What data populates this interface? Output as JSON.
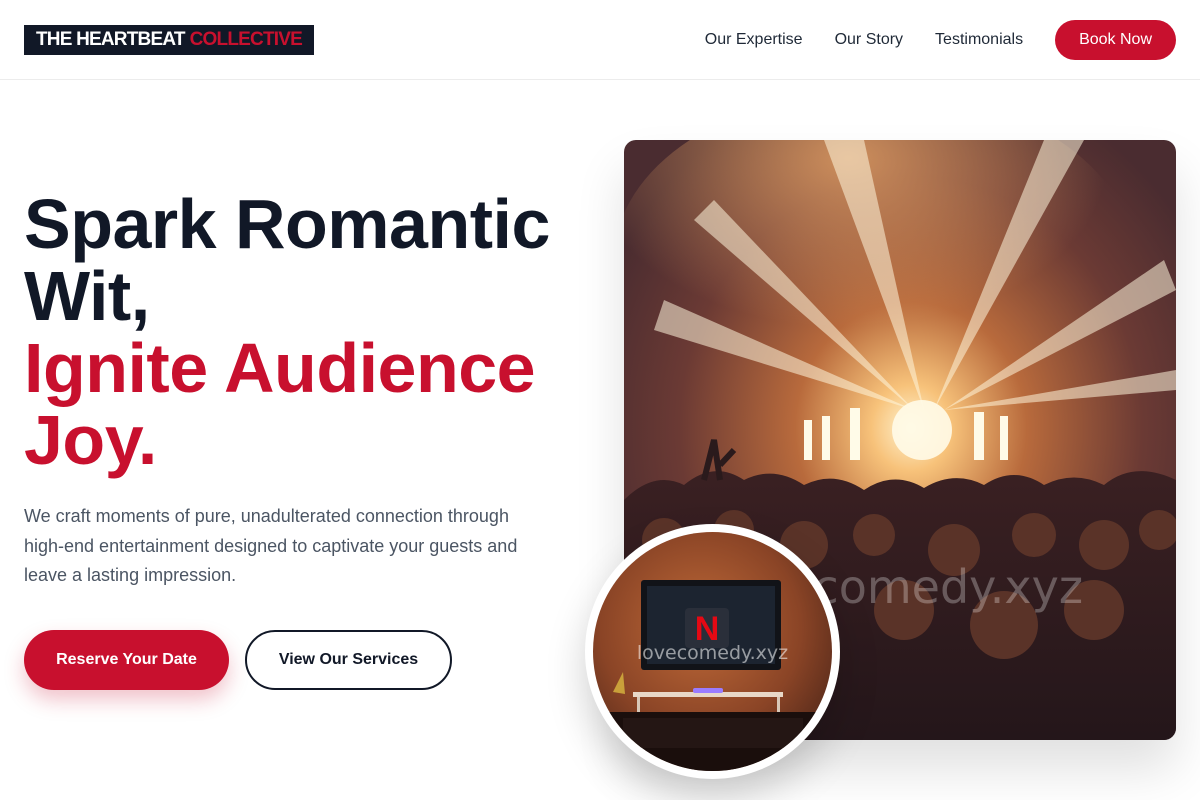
{
  "header": {
    "logo_part1": "THE HEARTBEAT",
    "logo_part2": "COLLECTIVE",
    "nav": [
      {
        "label": "Our Expertise"
      },
      {
        "label": "Our Story"
      },
      {
        "label": "Testimonials"
      }
    ],
    "book_label": "Book Now"
  },
  "hero": {
    "title_dark_1": "Spark Romantic",
    "title_dark_2": "Wit,",
    "title_red_1": "Ignite Audience",
    "title_red_2": "Joy.",
    "subtitle": "We craft moments of pure, unadulterated connection through high-end entertainment designed to captivate your guests and leave a lasting impression.",
    "primary_cta": "Reserve Your Date",
    "secondary_cta": "View Our Services"
  },
  "images": {
    "concert_watermark": "lovecomedy.xyz",
    "tv_watermark": "lovecomedy.xyz",
    "tv_logo": "N"
  },
  "colors": {
    "brand_red": "#c8102e",
    "dark": "#111827",
    "text_muted": "#4b5563"
  }
}
